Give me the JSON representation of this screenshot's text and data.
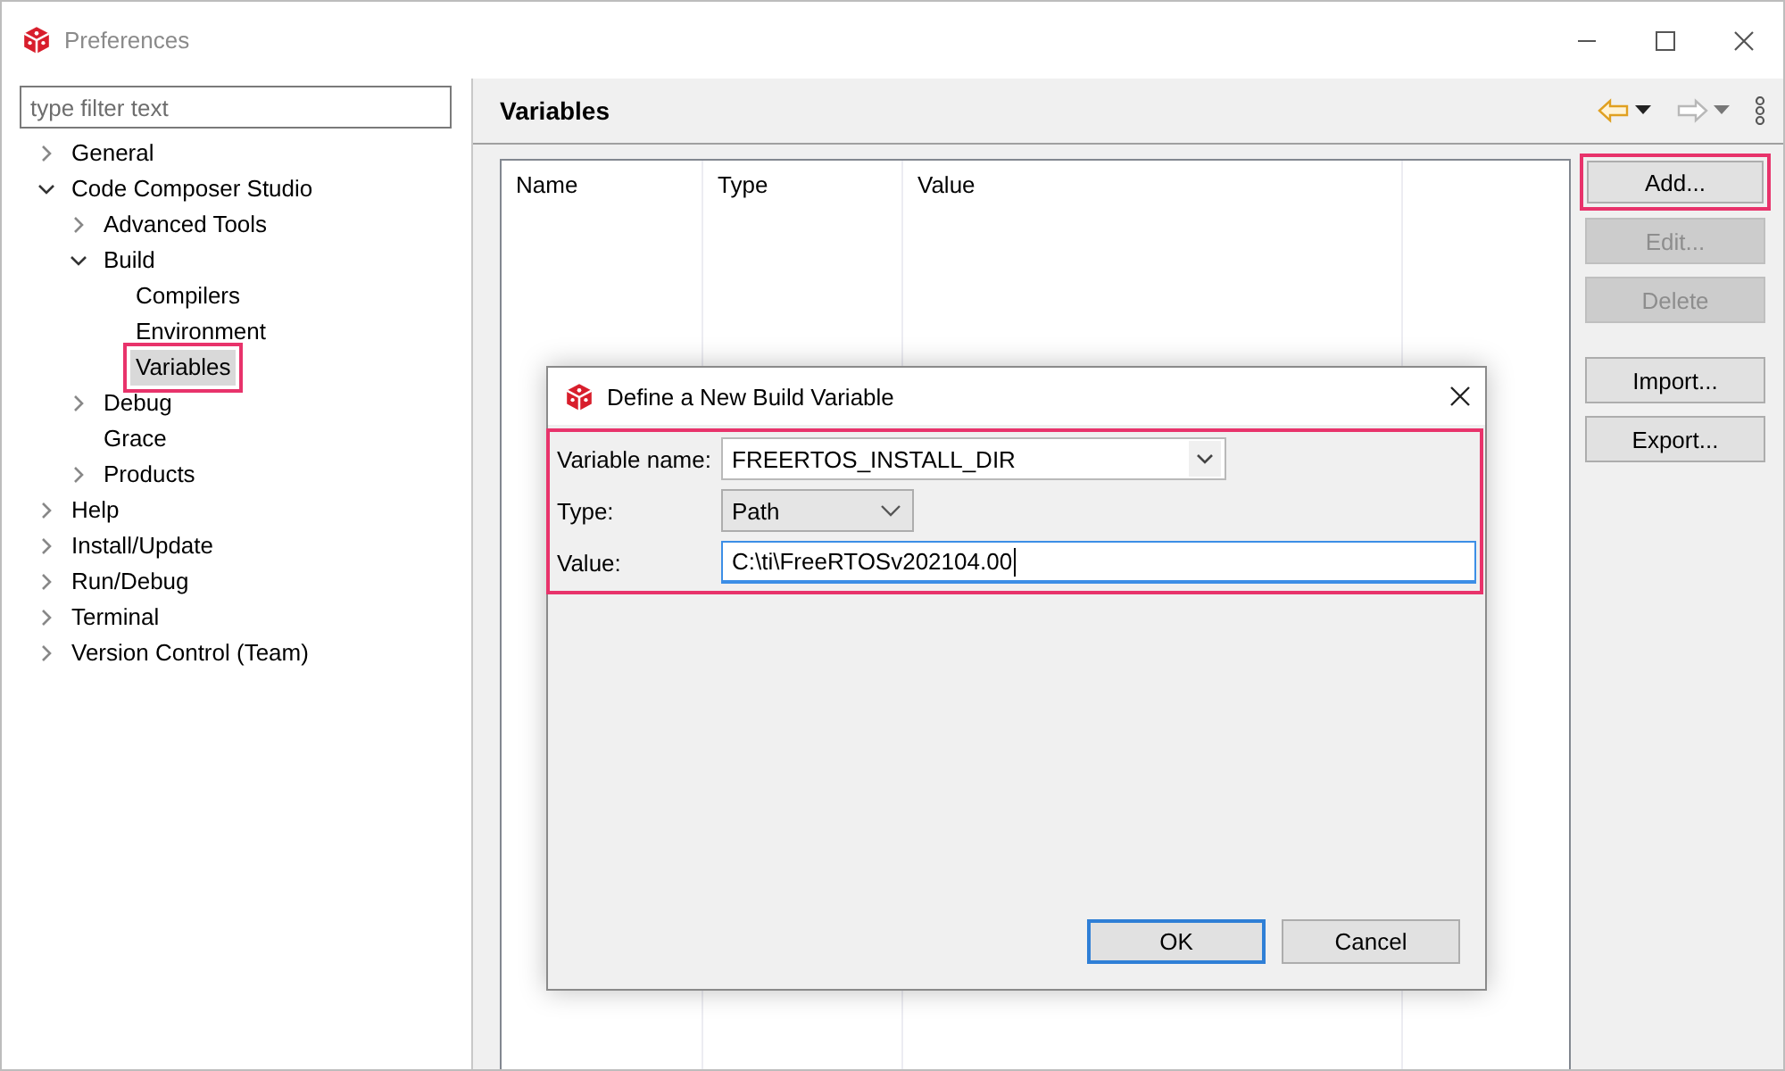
{
  "window": {
    "title": "Preferences"
  },
  "filter": {
    "placeholder": "type filter text"
  },
  "tree": [
    {
      "label": "General",
      "expanded": false,
      "selected": false,
      "highlighted": false
    },
    {
      "label": "Code Composer Studio",
      "expanded": true,
      "selected": false,
      "highlighted": false,
      "children": [
        {
          "label": "Advanced Tools",
          "expanded": false,
          "selected": false,
          "highlighted": false
        },
        {
          "label": "Build",
          "expanded": true,
          "selected": false,
          "highlighted": false,
          "children": [
            {
              "label": "Compilers",
              "selected": false,
              "highlighted": false
            },
            {
              "label": "Environment",
              "selected": false,
              "highlighted": false
            },
            {
              "label": "Variables",
              "selected": true,
              "highlighted": true
            }
          ]
        },
        {
          "label": "Debug",
          "expanded": false,
          "selected": false,
          "highlighted": false
        },
        {
          "label": "Grace",
          "selected": false,
          "highlighted": false
        },
        {
          "label": "Products",
          "expanded": false,
          "selected": false,
          "highlighted": false
        }
      ]
    },
    {
      "label": "Help",
      "expanded": false,
      "selected": false,
      "highlighted": false
    },
    {
      "label": "Install/Update",
      "expanded": false,
      "selected": false,
      "highlighted": false
    },
    {
      "label": "Run/Debug",
      "expanded": false,
      "selected": false,
      "highlighted": false
    },
    {
      "label": "Terminal",
      "expanded": false,
      "selected": false,
      "highlighted": false
    },
    {
      "label": "Version Control (Team)",
      "expanded": false,
      "selected": false,
      "highlighted": false
    }
  ],
  "panel": {
    "title": "Variables",
    "table": {
      "columns": [
        "Name",
        "Type",
        "Value"
      ]
    },
    "button_groups": [
      [
        {
          "label": "Add...",
          "disabled": false,
          "highlighted": true
        },
        {
          "label": "Edit...",
          "disabled": true,
          "highlighted": false
        },
        {
          "label": "Delete",
          "disabled": true,
          "highlighted": false
        }
      ],
      [
        {
          "label": "Import...",
          "disabled": false,
          "highlighted": false
        },
        {
          "label": "Export...",
          "disabled": false,
          "highlighted": false
        }
      ]
    ]
  },
  "dialog": {
    "title": "Define a New Build Variable",
    "highlighted": true,
    "fields": [
      {
        "kind": "combo",
        "label": "Variable name:",
        "value": "FREERTOS_INSTALL_DIR",
        "focused": false
      },
      {
        "kind": "dropdown",
        "label": "Type:",
        "value": "Path",
        "focused": false
      },
      {
        "kind": "text",
        "label": "Value:",
        "value": "C:\\ti\\FreeRTOSv202104.00",
        "focused": true
      }
    ],
    "buttons": [
      {
        "label": "OK",
        "default": true
      },
      {
        "label": "Cancel",
        "default": false
      }
    ]
  }
}
